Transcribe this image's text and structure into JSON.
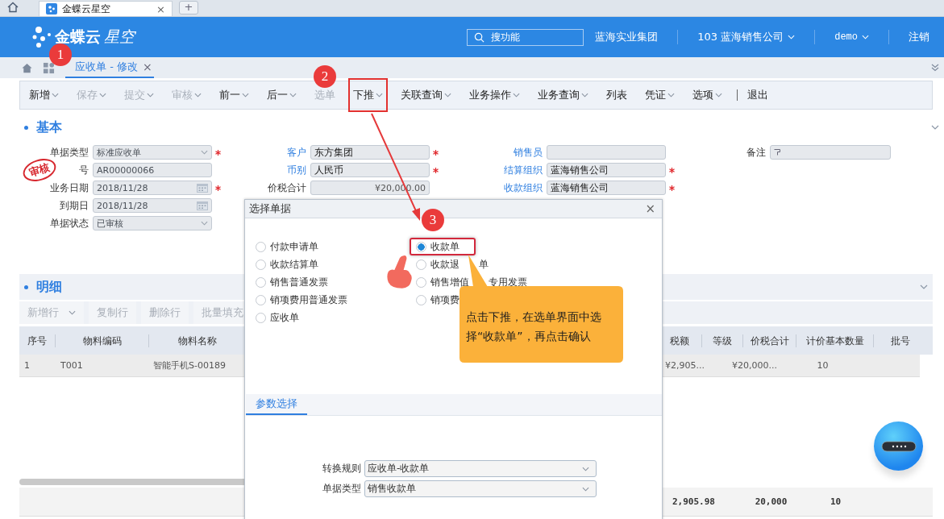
{
  "browser": {
    "tab_title": "金蝶云星空",
    "close": "×",
    "new_tab": "+"
  },
  "header": {
    "brand": "金蝶云",
    "product": "星空",
    "search": {
      "placeholder": "搜功能"
    },
    "group": "蓝海实业集团",
    "org": "103 蓝海销售公司",
    "user": "demo",
    "logout": "注销"
  },
  "page_tab": {
    "label": "应收单 - 修改",
    "close": "×",
    "selected": true
  },
  "toolbar": [
    {
      "label": "新增",
      "disabled": false,
      "dropdown": true,
      "highlighted": false,
      "divider_before": false
    },
    {
      "label": "保存",
      "disabled": true,
      "dropdown": true,
      "highlighted": false,
      "divider_before": false
    },
    {
      "label": "提交",
      "disabled": true,
      "dropdown": true,
      "highlighted": false,
      "divider_before": false
    },
    {
      "label": "审核",
      "disabled": true,
      "dropdown": true,
      "highlighted": false,
      "divider_before": false
    },
    {
      "label": "前一",
      "disabled": false,
      "dropdown": true,
      "highlighted": false,
      "divider_before": false
    },
    {
      "label": "后一",
      "disabled": false,
      "dropdown": true,
      "highlighted": false,
      "divider_before": false
    },
    {
      "label": "选单",
      "disabled": true,
      "dropdown": false,
      "highlighted": false,
      "divider_before": false
    },
    {
      "label": "下推",
      "disabled": false,
      "dropdown": true,
      "highlighted": true,
      "divider_before": false
    },
    {
      "label": "关联查询",
      "disabled": false,
      "dropdown": true,
      "highlighted": false,
      "divider_before": false
    },
    {
      "label": "业务操作",
      "disabled": false,
      "dropdown": true,
      "highlighted": false,
      "divider_before": false
    },
    {
      "label": "业务查询",
      "disabled": false,
      "dropdown": true,
      "highlighted": false,
      "divider_before": false
    },
    {
      "label": "列表",
      "disabled": false,
      "dropdown": false,
      "highlighted": false,
      "divider_before": false
    },
    {
      "label": "凭证",
      "disabled": false,
      "dropdown": true,
      "highlighted": false,
      "divider_before": false
    },
    {
      "label": "选项",
      "disabled": false,
      "dropdown": true,
      "highlighted": false,
      "divider_before": false
    },
    {
      "label": "退出",
      "disabled": false,
      "dropdown": false,
      "highlighted": false,
      "divider_before": true
    }
  ],
  "basic": {
    "title": "基本",
    "stamp": "审核",
    "columns": [
      [
        {
          "label": "单据类型",
          "link": false,
          "kind": "select",
          "value": "标准应收单",
          "required": true
        },
        {
          "label": "号",
          "link": false,
          "kind": "text",
          "value": "AR00000066",
          "required": false
        },
        {
          "label": "业务日期",
          "link": false,
          "kind": "date",
          "value": "2018/11/28",
          "required": true
        },
        {
          "label": "到期日",
          "link": false,
          "kind": "date",
          "value": "2018/11/28",
          "required": false
        },
        {
          "label": "单据状态",
          "link": false,
          "kind": "select",
          "value": "已审核",
          "required": false
        }
      ],
      [
        {
          "label": "客户",
          "link": true,
          "kind": "text",
          "value": "东方集团",
          "required": true
        },
        {
          "label": "币别",
          "link": true,
          "kind": "text",
          "value": "人民币",
          "required": true
        },
        {
          "label": "价税合计",
          "link": false,
          "kind": "amount",
          "value": "¥20,000.00",
          "required": false
        }
      ],
      [
        {
          "label": "销售员",
          "link": true,
          "kind": "text",
          "required": false
        },
        {
          "label": "结算组织",
          "link": true,
          "kind": "text",
          "value": "蓝海销售公司",
          "required": true
        },
        {
          "label": "收款组织",
          "link": true,
          "kind": "text",
          "value": "蓝海销售公司",
          "required": true
        }
      ],
      [
        {
          "label": "备注",
          "link": false,
          "kind": "note",
          "required": false
        }
      ]
    ]
  },
  "detail": {
    "title": "明细",
    "actions": [
      {
        "label": "新增行",
        "dropdown": true
      },
      {
        "label": "复制行",
        "dropdown": false
      },
      {
        "label": "删除行",
        "dropdown": false
      },
      {
        "label": "批量填充",
        "dropdown": false
      }
    ],
    "table": {
      "columns": [
        {
          "label": "序号",
          "cell": "1"
        },
        {
          "label": "物料编码",
          "cell": "T001"
        },
        {
          "label": "物料名称",
          "cell": "智能手机S-00189"
        },
        {
          "label": "税额",
          "cell": "¥2,905...",
          "total": "2,905.98"
        },
        {
          "label": "等级"
        },
        {
          "label": "价税合计",
          "cell": "¥20,000...",
          "total": "20,000"
        },
        {
          "label": "计价基本数量",
          "cell": "10",
          "total": "10"
        },
        {
          "label": "批号"
        }
      ]
    }
  },
  "dialog": {
    "title": "选择单据",
    "close": "×",
    "options": [
      {
        "label": "付款申请单",
        "selected": false,
        "highlighted": false
      },
      {
        "label": "收款单",
        "selected": true,
        "highlighted": true
      },
      {
        "label": "收款结算单",
        "selected": false,
        "highlighted": false
      },
      {
        "label": "收款退",
        "after": "单",
        "selected": false,
        "highlighted": false
      },
      {
        "label": "销售普通发票",
        "selected": false,
        "highlighted": false
      },
      {
        "label": "销售增值",
        "after": "专用发票",
        "selected": false,
        "highlighted": false
      },
      {
        "label": "销项费用普通发票",
        "selected": false,
        "highlighted": false
      },
      {
        "label": "销项费",
        "selected": false,
        "highlighted": false
      },
      {
        "label": "应收单",
        "selected": false,
        "highlighted": false
      }
    ],
    "tab": {
      "label": "参数选择",
      "selected": true
    },
    "fields": [
      {
        "label": "转换规则",
        "value": "应收单-收款单"
      },
      {
        "label": "单据类型",
        "value": "销售收款单"
      }
    ]
  },
  "annotations": {
    "steps": [
      "1",
      "2",
      "3"
    ],
    "callout": "点击下推，在选单界面中选择“收款单”，再点击确认"
  }
}
